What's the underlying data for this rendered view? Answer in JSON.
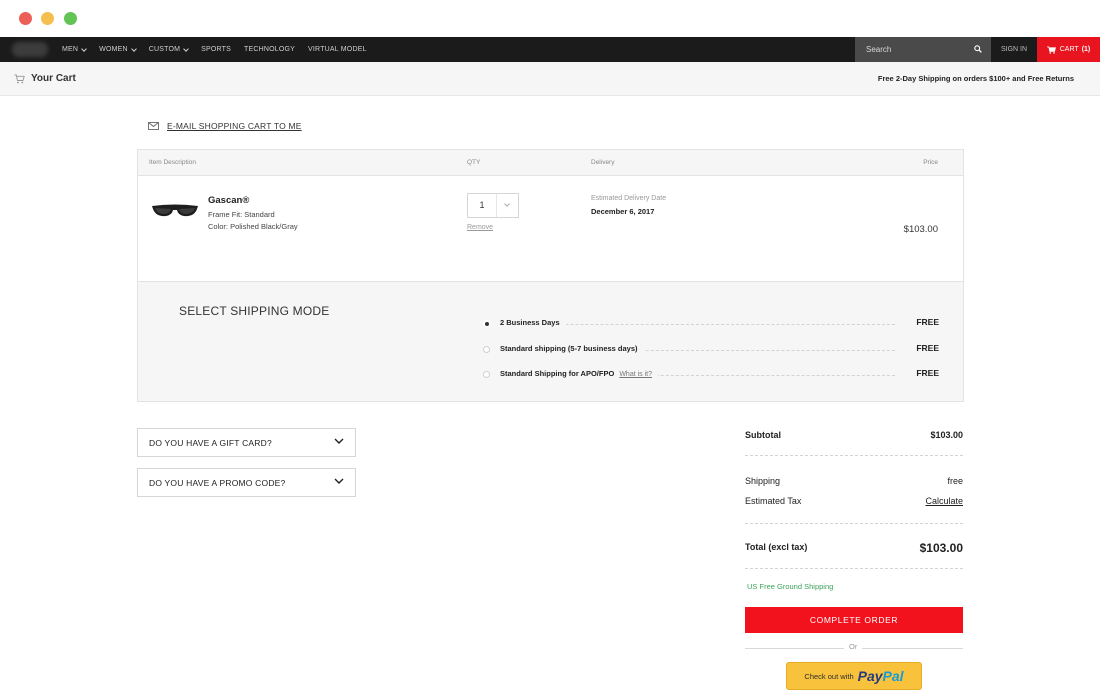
{
  "nav": {
    "links": [
      "MEN",
      "WOMEN",
      "CUSTOM",
      "SPORTS",
      "TECHNOLOGY",
      "VIRTUAL MODEL"
    ],
    "search_placeholder": "Search",
    "sign_in": "SIGN IN",
    "cart_label": "CART",
    "cart_count": "(1)"
  },
  "subheader": {
    "title": "Your Cart",
    "promo": "Free 2-Day Shipping on orders $100+ and Free Returns"
  },
  "email_link": "E-MAIL SHOPPING CART TO ME",
  "table": {
    "headers": {
      "item": "Item Description",
      "qty": "QTY",
      "delivery": "Delivery",
      "price": "Price"
    },
    "item": {
      "name": "Gascan®",
      "frame_fit": "Frame Fit: Standard",
      "color": "Color:  Polished Black/Gray",
      "qty": "1",
      "remove": "Remove",
      "est_label": "Estimated Delivery Date",
      "est_date": "December 6, 2017",
      "price": "$103.00"
    }
  },
  "shipping": {
    "title": "SELECT SHIPPING MODE",
    "options": [
      {
        "label": "2 Business Days",
        "price": "FREE",
        "selected": true
      },
      {
        "label": "Standard shipping (5-7 business days)",
        "price": "FREE",
        "selected": false
      },
      {
        "label": "Standard Shipping for APO/FPO",
        "link": "What is it?",
        "price": "FREE",
        "selected": false
      }
    ]
  },
  "gift_card": "DO YOU HAVE A GIFT CARD?",
  "promo_code": "DO YOU HAVE A PROMO CODE?",
  "summary": {
    "subtotal_label": "Subtotal",
    "subtotal": "$103.00",
    "shipping_label": "Shipping",
    "shipping": "free",
    "tax_label": "Estimated Tax",
    "tax": "Calculate",
    "total_label": "Total  (excl tax)",
    "total": "$103.00",
    "us_free": "US Free Ground Shipping",
    "complete": "COMPLETE ORDER",
    "or": "Or",
    "paypal_prefix": "Check out with",
    "paypal_1": "Pay",
    "paypal_2": "Pal"
  },
  "colors": {
    "accent_red": "#f2121e",
    "nav_bg": "#1b1b1b",
    "green": "#3aa35b",
    "paypal_yellow": "#f9c23c"
  }
}
